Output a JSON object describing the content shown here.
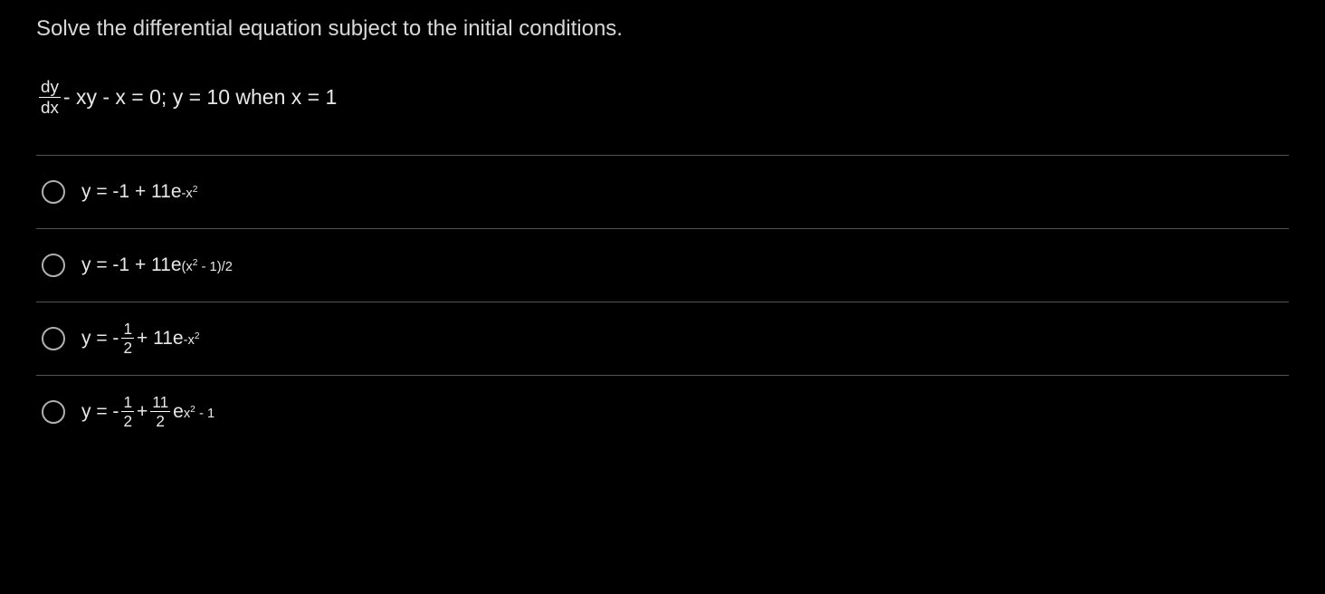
{
  "prompt": "Solve the differential equation subject to the initial conditions.",
  "equation": {
    "frac_num": "dy",
    "frac_den": "dx",
    "rest": " - xy - x = 0; y = 10 when x = 1"
  },
  "options": {
    "a": {
      "pre": "y = -1 + 11e",
      "sup_pre": "-x",
      "sup_sup": "2"
    },
    "b": {
      "pre": "y = -1 + 11e",
      "sup_pre": "(x",
      "sup_sup": "2",
      "sup_post": " - 1)/2"
    },
    "c": {
      "pre": "y = - ",
      "frac_num": "1",
      "frac_den": "2",
      "mid": " + 11e",
      "sup_pre": "-x",
      "sup_sup": "2"
    },
    "d": {
      "pre": "y = - ",
      "frac1_num": "1",
      "frac1_den": "2",
      "mid1": " + ",
      "frac2_num": "11",
      "frac2_den": "2",
      "mid2": "e",
      "sup_pre": "x",
      "sup_sup": "2",
      "sup_post": " - 1"
    }
  }
}
